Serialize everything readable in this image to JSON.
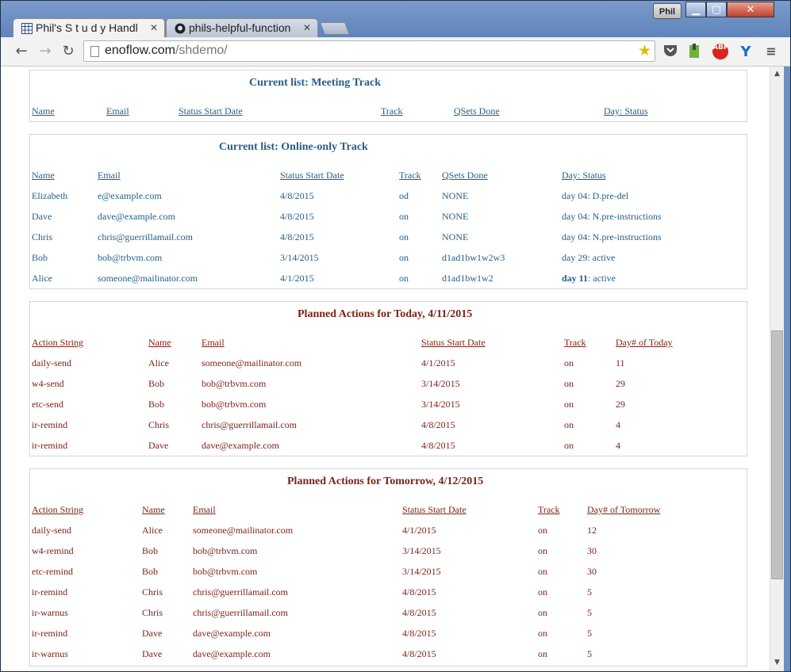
{
  "browser": {
    "profile": "Phil",
    "tabs": [
      {
        "title": "Phil's S t u d y Handl",
        "close": "✕"
      },
      {
        "title": "phils-helpful-function",
        "close": "✕"
      }
    ],
    "url_host": "enoflow.com",
    "url_path": "/shdemo/",
    "window_buttons": {
      "minimize": "▁",
      "maximize": "▢",
      "close": "✕"
    },
    "extensions": {
      "abp": "ABP"
    },
    "icons": [
      "back-icon",
      "forward-icon",
      "reload-icon",
      "star-icon",
      "pocket-icon",
      "evernote-icon",
      "adblock-icon",
      "extension-y-icon",
      "menu-icon"
    ]
  },
  "meeting": {
    "title": "Current list: Meeting Track",
    "headers": [
      "Name",
      "Email",
      "Status Start Date",
      "Track",
      "QSets Done",
      "Day: Status"
    ]
  },
  "online": {
    "title": "Current list: Online-only Track",
    "headers": [
      "Name",
      "Email",
      "Status Start Date",
      "Track",
      "QSets Done",
      "Day: Status"
    ],
    "rows": [
      {
        "name": "Elizabeth",
        "email": "e@example.com",
        "date": "4/8/2015",
        "track": "od",
        "qsets": "NONE",
        "day": "day 04",
        "status": ": D.pre-del"
      },
      {
        "name": "Dave",
        "email": "dave@example.com",
        "date": "4/8/2015",
        "track": "on",
        "qsets": "NONE",
        "day": "day 04",
        "status": ": N.pre-instructions"
      },
      {
        "name": "Chris",
        "email": "chris@guerrillamail.com",
        "date": "4/8/2015",
        "track": "on",
        "qsets": "NONE",
        "day": "day 04",
        "status": ": N.pre-instructions"
      },
      {
        "name": "Bob",
        "email": "bob@trbvm.com",
        "date": "3/14/2015",
        "track": "on",
        "qsets": "d1ad1bw1w2w3",
        "day": "day 29",
        "status": ": active"
      },
      {
        "name": "Alice",
        "email": "someone@mailinator.com",
        "date": "4/1/2015",
        "track": "on",
        "qsets": "d1ad1bw1w2",
        "day": "day 11",
        "status": ": active"
      }
    ]
  },
  "today": {
    "title": "Planned Actions for Today, 4/11/2015",
    "headers": [
      "Action String",
      "Name",
      "Email",
      "Status Start Date",
      "Track",
      "Day# of Today"
    ],
    "rows": [
      {
        "action": "daily-send",
        "name": "Alice",
        "email": "someone@mailinator.com",
        "date": "4/1/2015",
        "track": "on",
        "day": "11"
      },
      {
        "action": "w4-send",
        "name": "Bob",
        "email": "bob@trbvm.com",
        "date": "3/14/2015",
        "track": "on",
        "day": "29"
      },
      {
        "action": "etc-send",
        "name": "Bob",
        "email": "bob@trbvm.com",
        "date": "3/14/2015",
        "track": "on",
        "day": "29"
      },
      {
        "action": "ir-remind",
        "name": "Chris",
        "email": "chris@guerrillamail.com",
        "date": "4/8/2015",
        "track": "on",
        "day": "4"
      },
      {
        "action": "ir-remind",
        "name": "Dave",
        "email": "dave@example.com",
        "date": "4/8/2015",
        "track": "on",
        "day": "4"
      }
    ]
  },
  "tomorrow": {
    "title": "Planned Actions for Tomorrow, 4/12/2015",
    "headers": [
      "Action String",
      "Name",
      "Email",
      "Status Start Date",
      "Track",
      "Day# of Tomorrow"
    ],
    "rows": [
      {
        "action": "daily-send",
        "name": "Alice",
        "email": "someone@mailinator.com",
        "date": "4/1/2015",
        "track": "on",
        "day": "12"
      },
      {
        "action": "w4-remind",
        "name": "Bob",
        "email": "bob@trbvm.com",
        "date": "3/14/2015",
        "track": "on",
        "day": "30"
      },
      {
        "action": "etc-remind",
        "name": "Bob",
        "email": "bob@trbvm.com",
        "date": "3/14/2015",
        "track": "on",
        "day": "30"
      },
      {
        "action": "ir-remind",
        "name": "Chris",
        "email": "chris@guerrillamail.com",
        "date": "4/8/2015",
        "track": "on",
        "day": "5"
      },
      {
        "action": "ir-warnus",
        "name": "Chris",
        "email": "chris@guerrillamail.com",
        "date": "4/8/2015",
        "track": "on",
        "day": "5"
      },
      {
        "action": "ir-remind",
        "name": "Dave",
        "email": "dave@example.com",
        "date": "4/8/2015",
        "track": "on",
        "day": "5"
      },
      {
        "action": "ir-warnus",
        "name": "Dave",
        "email": "dave@example.com",
        "date": "4/8/2015",
        "track": "on",
        "day": "5"
      }
    ]
  },
  "colors": {
    "blue_text": "#245e8c",
    "red_text": "#7b2318",
    "chrome_frame": "#6f8fc0"
  }
}
